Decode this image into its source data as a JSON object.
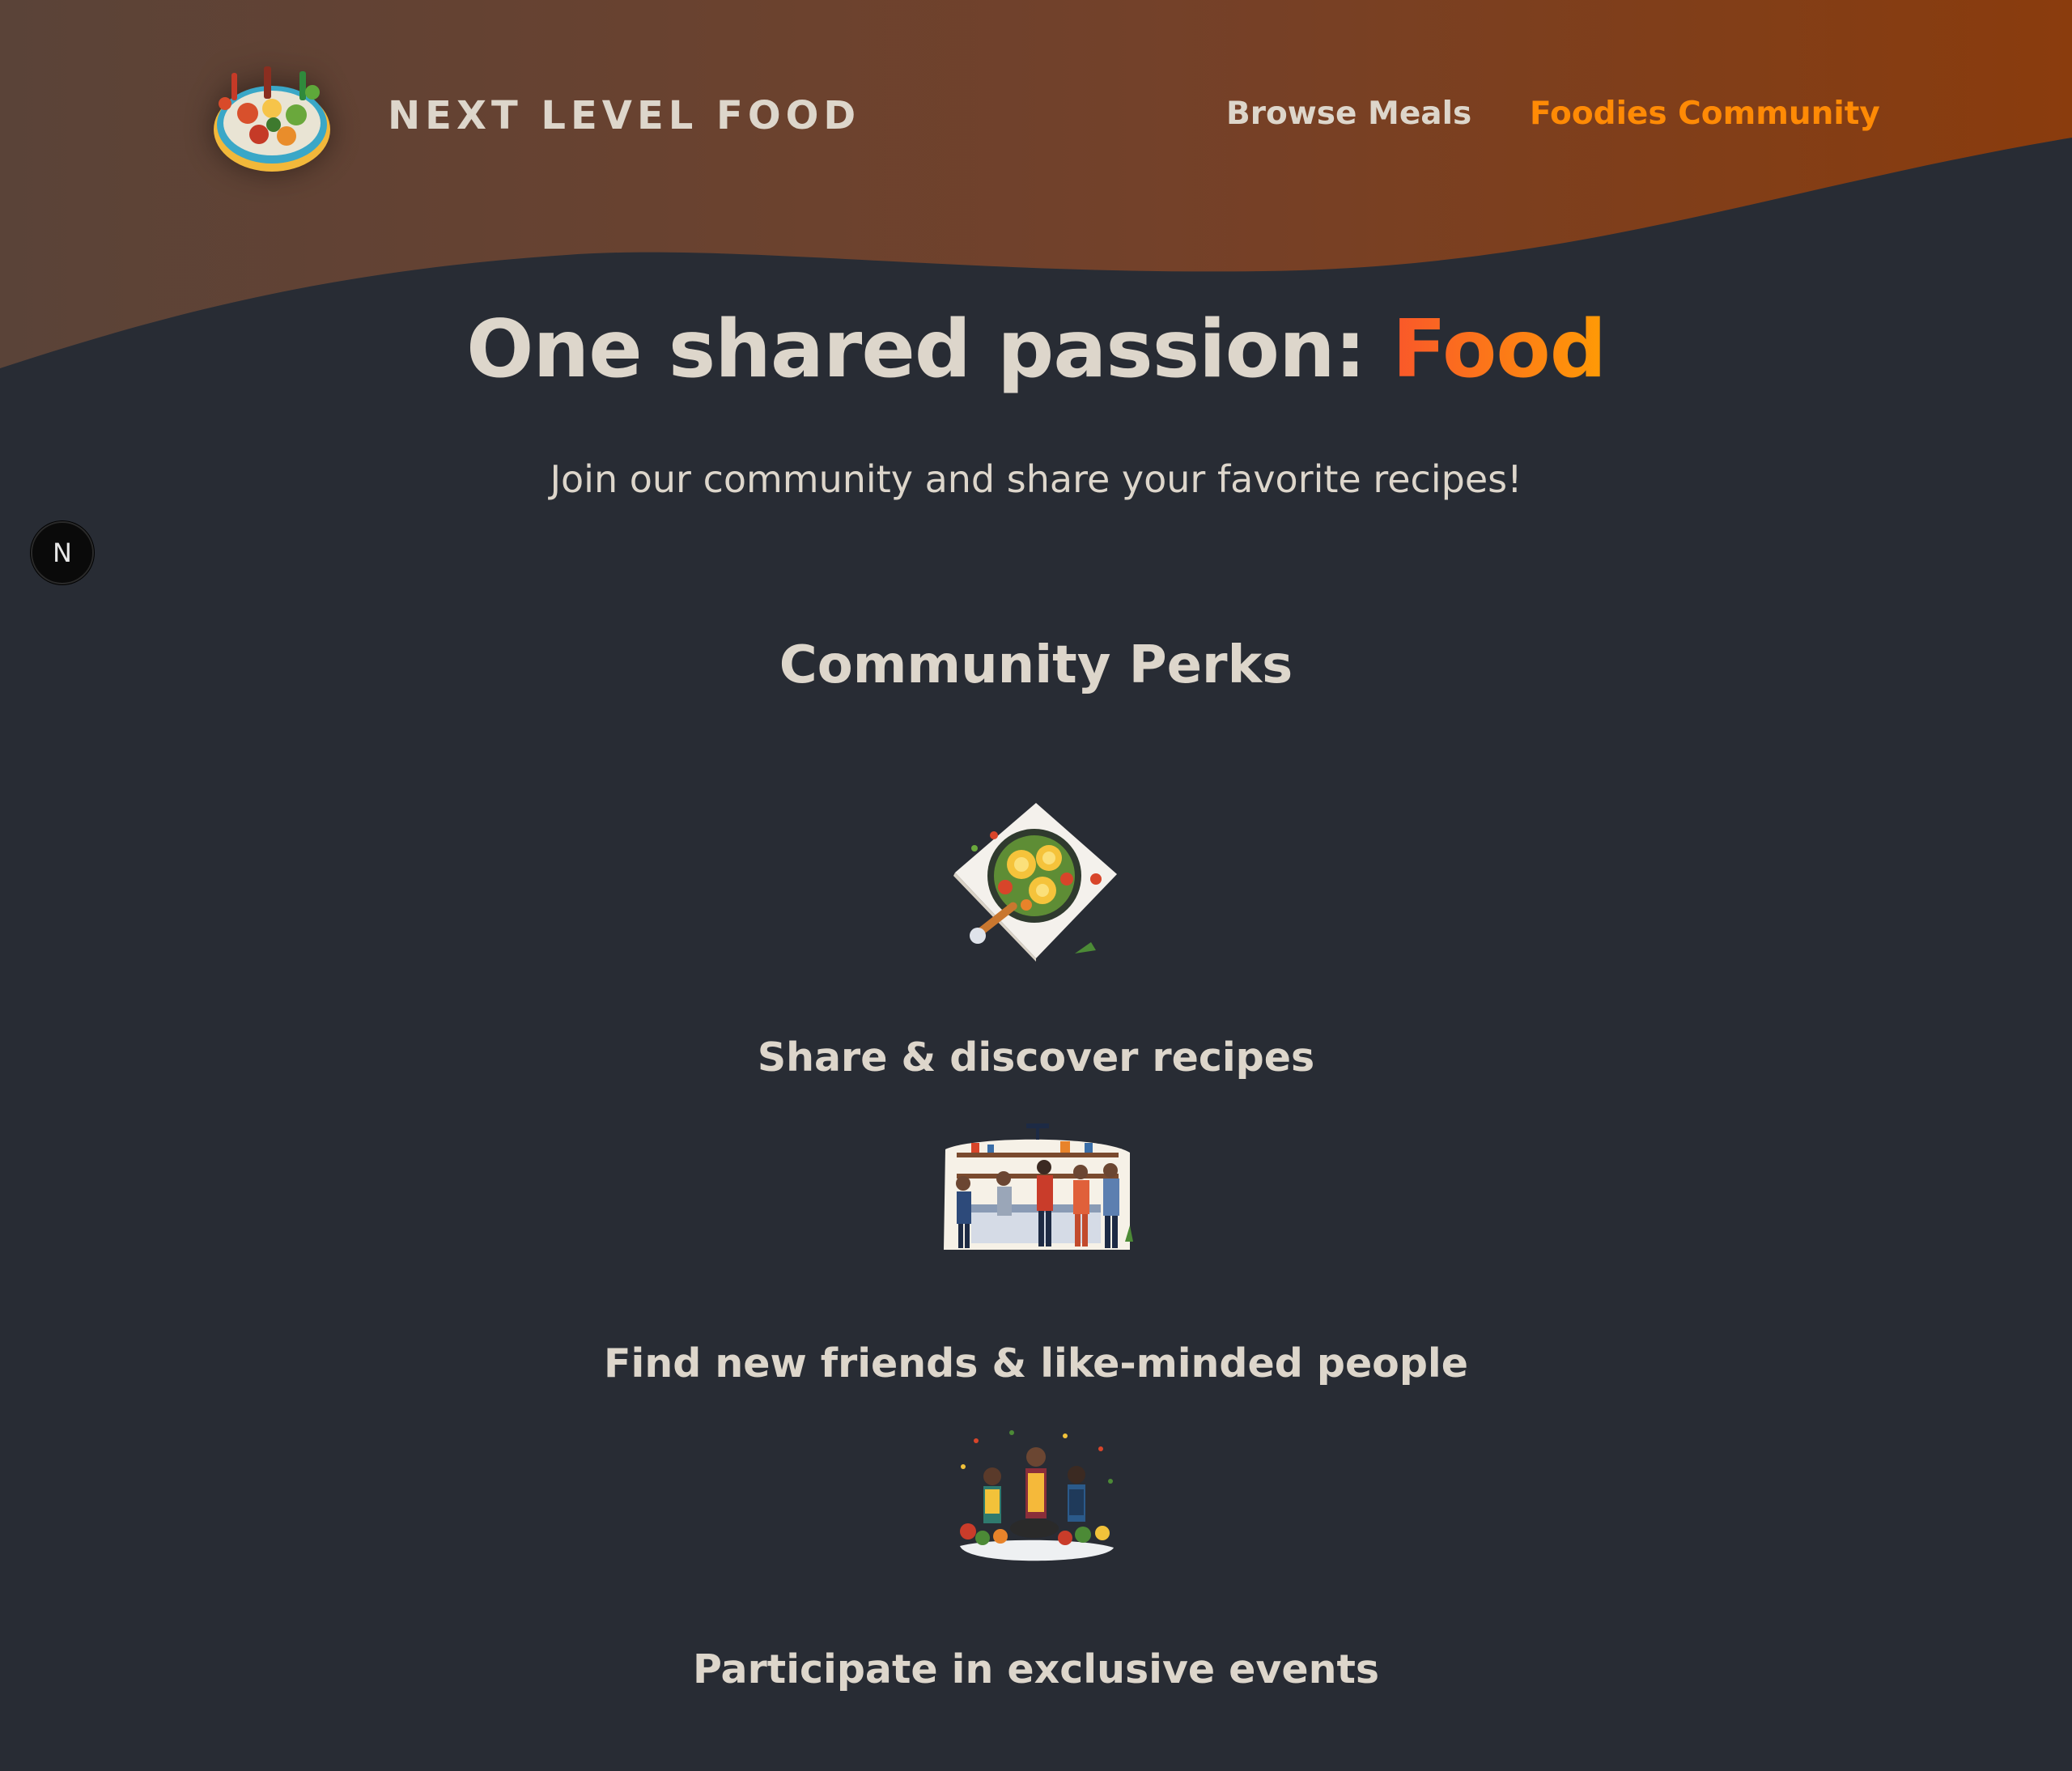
{
  "header": {
    "logo_text": "NEXT LEVEL FOOD",
    "logo_icon": "plate-of-food-logo",
    "nav": [
      {
        "label": "Browse Meals",
        "active": false
      },
      {
        "label": "Foodies Community",
        "active": true
      }
    ]
  },
  "dev_badge": {
    "label": "N"
  },
  "hero": {
    "title_prefix": "One shared passion: ",
    "title_highlight": "Food",
    "subtitle": "Join our community and share your favorite recipes!"
  },
  "perks": {
    "title": "Community Perks",
    "items": [
      {
        "label": "Share & discover recipes",
        "icon": "recipe-plate-illustration"
      },
      {
        "label": "Find new friends & like-minded people",
        "icon": "community-kitchen-illustration"
      },
      {
        "label": "Participate in exclusive events",
        "icon": "cooking-event-illustration"
      }
    ]
  },
  "colors": {
    "background": "#282c34",
    "header_gradient_start": "#5a4338",
    "header_gradient_end": "#8a3c0d",
    "text": "#ddd6cb",
    "accent": "#ff8a05",
    "highlight_start": "#f9572a",
    "highlight_end": "#ff9b05"
  }
}
